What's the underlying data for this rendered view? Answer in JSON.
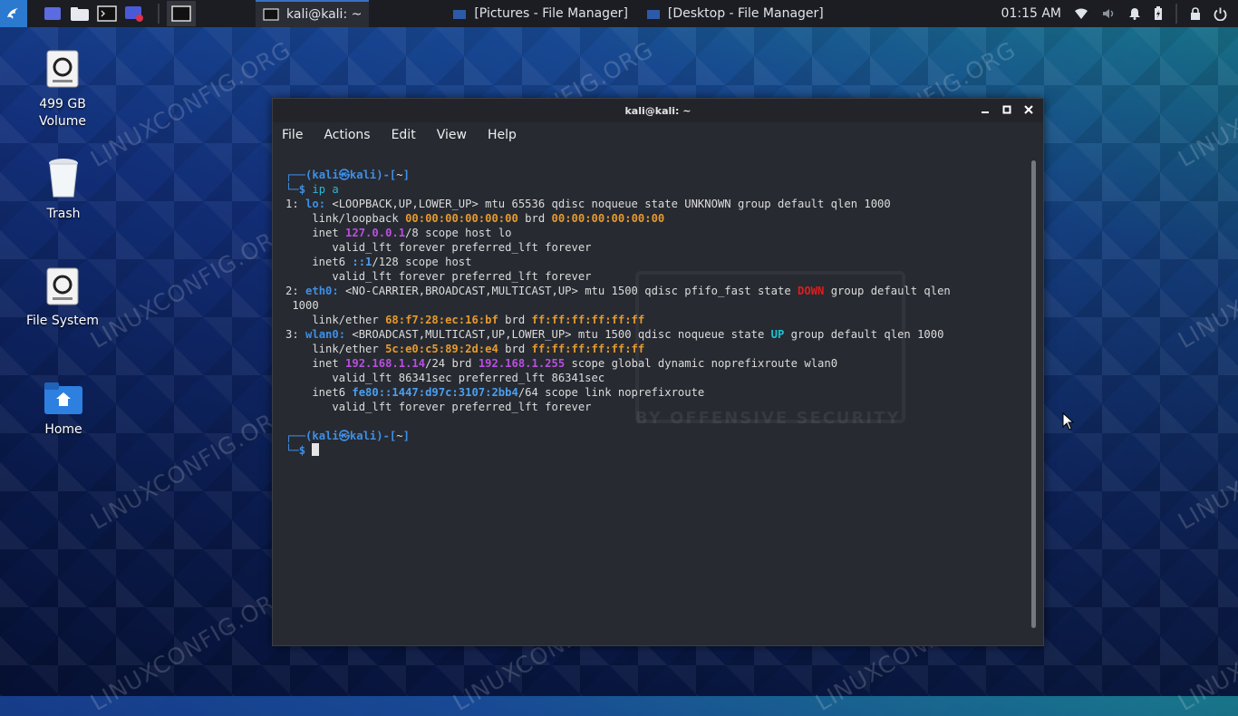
{
  "taskbar": {
    "tasks": [
      {
        "label": "kali@kali: ~",
        "active": true
      },
      {
        "label": "[Pictures - File Manager]",
        "active": false
      },
      {
        "label": "[Desktop - File Manager]",
        "active": false
      }
    ],
    "clock": "01:15 AM"
  },
  "desktop": {
    "icons": [
      {
        "label": "499 GB\nVolume"
      },
      {
        "label": "Trash"
      },
      {
        "label": "File System"
      },
      {
        "label": "Home"
      }
    ]
  },
  "watermark": "LINUXCONFIG.ORG",
  "terminal": {
    "title": "kali@kali: ~",
    "menu": [
      "File",
      "Actions",
      "Edit",
      "View",
      "Help"
    ],
    "background_logo_text": "BY OFFENSIVE SECURITY",
    "lines": [
      [
        [
          "┌──(",
          "blue"
        ],
        [
          "kali㉿kali",
          "blue"
        ],
        [
          ")-[",
          "blue"
        ],
        [
          "~",
          ""
        ],
        [
          "]",
          "blue"
        ]
      ],
      [
        [
          "└─",
          "blue"
        ],
        [
          "$ ",
          "blue"
        ],
        [
          "ip a",
          "cyan"
        ]
      ],
      [
        [
          "1: ",
          ""
        ],
        [
          "lo:",
          "blue"
        ],
        [
          " <LOOPBACK,UP,LOWER_UP> mtu 65536 qdisc noqueue state UNKNOWN group default qlen 1000",
          ""
        ]
      ],
      [
        [
          "    link/loopback ",
          ""
        ],
        [
          "00:00:00:00:00:00",
          "orange"
        ],
        [
          " brd ",
          ""
        ],
        [
          "00:00:00:00:00:00",
          "orange"
        ]
      ],
      [
        [
          "    inet ",
          ""
        ],
        [
          "127.0.0.1",
          "purple"
        ],
        [
          "/8 scope host lo",
          ""
        ]
      ],
      [
        [
          "       valid_lft forever preferred_lft forever",
          ""
        ]
      ],
      [
        [
          "    inet6 ",
          ""
        ],
        [
          "::1",
          "fe80"
        ],
        [
          "/128 scope host",
          ""
        ]
      ],
      [
        [
          "       valid_lft forever preferred_lft forever",
          ""
        ]
      ],
      [
        [
          "2: ",
          ""
        ],
        [
          "eth0:",
          "blue"
        ],
        [
          " <NO-CARRIER,BROADCAST,MULTICAST,UP> mtu 1500 qdisc pfifo_fast state ",
          ""
        ],
        [
          "DOWN",
          "red"
        ],
        [
          " group default qlen",
          ""
        ]
      ],
      [
        [
          " 1000",
          ""
        ]
      ],
      [
        [
          "    link/ether ",
          ""
        ],
        [
          "68:f7:28:ec:16:bf",
          "orange"
        ],
        [
          " brd ",
          ""
        ],
        [
          "ff:ff:ff:ff:ff:ff",
          "orange"
        ]
      ],
      [
        [
          "3: ",
          ""
        ],
        [
          "wlan0:",
          "blue"
        ],
        [
          " <BROADCAST,MULTICAST,UP,LOWER_UP> mtu 1500 qdisc noqueue state ",
          ""
        ],
        [
          "UP",
          "green"
        ],
        [
          " group default qlen 1000",
          ""
        ]
      ],
      [
        [
          "    link/ether ",
          ""
        ],
        [
          "5c:e0:c5:89:2d:e4",
          "orange"
        ],
        [
          " brd ",
          ""
        ],
        [
          "ff:ff:ff:ff:ff:ff",
          "orange"
        ]
      ],
      [
        [
          "    inet ",
          ""
        ],
        [
          "192.168.1.14",
          "purple"
        ],
        [
          "/24 brd ",
          ""
        ],
        [
          "192.168.1.255",
          "purple"
        ],
        [
          " scope global dynamic noprefixroute wlan0",
          ""
        ]
      ],
      [
        [
          "       valid_lft 86341sec preferred_lft 86341sec",
          ""
        ]
      ],
      [
        [
          "    inet6 ",
          ""
        ],
        [
          "fe80::1447:d97c:3107:2bb4",
          "fe80"
        ],
        [
          "/64 scope link noprefixroute",
          ""
        ]
      ],
      [
        [
          "       valid_lft forever preferred_lft forever",
          ""
        ]
      ],
      [
        [
          "",
          ""
        ]
      ],
      [
        [
          "┌──(",
          "blue"
        ],
        [
          "kali㉿kali",
          "blue"
        ],
        [
          ")-[",
          "blue"
        ],
        [
          "~",
          ""
        ],
        [
          "]",
          "blue"
        ]
      ],
      [
        [
          "└─",
          "blue"
        ],
        [
          "$ ",
          "blue"
        ]
      ]
    ]
  },
  "colors": {
    "accent": "#2b7ad0",
    "terminal_bg": "#272a31",
    "prompt_blue": "#3e8fe6",
    "mac_orange": "#e79a2c",
    "ip_purple": "#b94fe0",
    "state_down_red": "#e11c1c",
    "state_up_cyan": "#1ec2d1"
  }
}
